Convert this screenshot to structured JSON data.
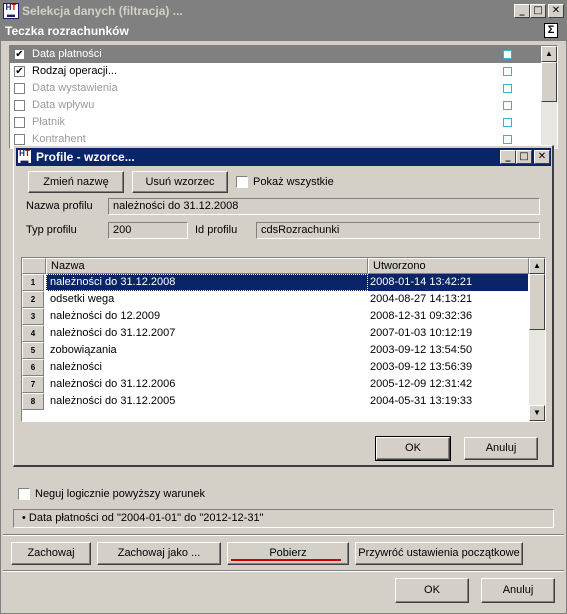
{
  "window": {
    "title": "Selekcja danych (filtracja) ...",
    "section_title": "Teczka rozrachunków",
    "sigma": "Σ"
  },
  "fields": [
    {
      "label": "Data płatności",
      "checked": true,
      "selected": true
    },
    {
      "label": "Rodzaj operacji...",
      "checked": true,
      "selected": false
    },
    {
      "label": "Data wystawienia",
      "checked": false,
      "selected": false
    },
    {
      "label": "Data wpływu",
      "checked": false,
      "selected": false
    },
    {
      "label": "Płatnik",
      "checked": false,
      "selected": false
    },
    {
      "label": "Kontrahent",
      "checked": false,
      "selected": false
    }
  ],
  "dialog": {
    "title": "Profile - wzorce...",
    "rename_button": "Zmień nazwę",
    "delete_button": "Usuń wzorzec",
    "show_all_label": "Pokaż wszystkie",
    "profile_name_label": "Nazwa profilu",
    "profile_name_value": "należności do 31.12.2008",
    "profile_type_label": "Typ profilu",
    "profile_type_value": "200",
    "profile_id_label": "Id profilu",
    "profile_id_value": "cdsRozrachunki",
    "col_name": "Nazwa",
    "col_created": "Utworzono",
    "rows": [
      {
        "num": "1",
        "name": "należności do 31.12.2008",
        "created": "2008-01-14 13:42:21"
      },
      {
        "num": "2",
        "name": "odsetki wega",
        "created": "2004-08-27 14:13:21"
      },
      {
        "num": "3",
        "name": "należności do 12.2009",
        "created": "2008-12-31 09:32:36"
      },
      {
        "num": "4",
        "name": "należności do 31.12.2007",
        "created": "2007-01-03 10:12:19"
      },
      {
        "num": "5",
        "name": "zobowiązania",
        "created": "2003-09-12 13:54:50"
      },
      {
        "num": "6",
        "name": "należności",
        "created": "2003-09-12 13:56:39"
      },
      {
        "num": "7",
        "name": "należności do 31.12.2006",
        "created": "2005-12-09 12:31:42"
      },
      {
        "num": "8",
        "name": "należności do 31.12.2005",
        "created": "2004-05-31 13:19:33"
      }
    ],
    "ok_button": "OK",
    "cancel_button": "Anuluj"
  },
  "negate_label": "Neguj logicznie powyższy warunek",
  "condition_text": "Data płatności od \"2004-01-01\" do \"2012-12-31\"",
  "bottom": {
    "save": "Zachowaj",
    "save_as": "Zachowaj jako ...",
    "load": "Pobierz",
    "restore": "Przywróć ustawienia początkowe",
    "ok": "OK",
    "cancel": "Anuluj"
  },
  "colors": {
    "selection": "#0a246a",
    "inactive_title": "#808080",
    "accent_underline": "#cc0000",
    "field_marker": "#2fb8c8"
  }
}
